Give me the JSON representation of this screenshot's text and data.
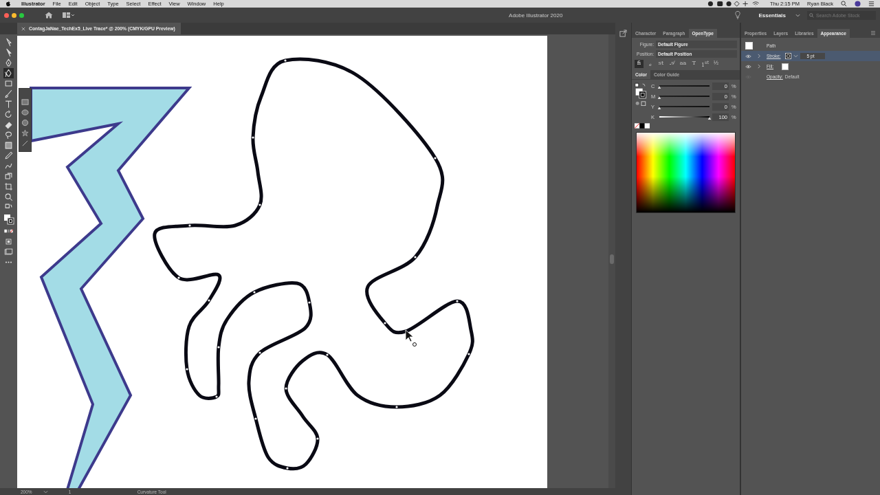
{
  "menu_bar": {
    "app": "Illustrator",
    "items": [
      "File",
      "Edit",
      "Object",
      "Type",
      "Select",
      "Effect",
      "View",
      "Window",
      "Help"
    ],
    "clock": "Thu 2:15 PM",
    "user": "Ryan Black"
  },
  "title_bar": {
    "title": "Adobe Illustrator 2020",
    "workspace": "Essentials",
    "search": {
      "placeholder": "Search Adobe Stock"
    }
  },
  "document_tab": {
    "title": "ContagJaNae_TechEx5_Live Trace* @ 200% (CMYK/GPU Preview)"
  },
  "toolbar": {
    "tools": [
      {
        "selected": false
      },
      {
        "selected": false
      },
      {
        "selected": false
      },
      {
        "selected": true
      },
      {
        "selected": false
      },
      {
        "selected": false
      },
      {
        "selected": false
      },
      {
        "selected": false
      },
      {
        "selected": false
      },
      {
        "selected": false
      },
      {
        "selected": false
      },
      {
        "selected": false
      },
      {
        "selected": false
      },
      {
        "selected": false
      },
      {
        "selected": false
      },
      {
        "selected": false
      },
      {
        "selected": false
      }
    ]
  },
  "opentype_panel": {
    "tabs": [
      {
        "label": "Character",
        "selected": false
      },
      {
        "label": "Paragraph",
        "selected": false
      },
      {
        "label": "OpenType",
        "selected": true
      }
    ],
    "figure": {
      "label": "Figure:",
      "value": "Default Figure"
    },
    "position": {
      "label": "Position:",
      "value": "Default Position"
    },
    "glyphs": [
      {
        "label": "ﬁ",
        "selected": true
      },
      {
        "label": "ℴ",
        "selected": false
      },
      {
        "label": "st",
        "selected": false
      },
      {
        "label": "𝒜",
        "selected": false
      },
      {
        "label": "aa",
        "selected": false
      },
      {
        "label": "T",
        "selected": false
      },
      {
        "label": "1$^{st}$",
        "selected": false
      },
      {
        "label": "½",
        "selected": false
      }
    ]
  },
  "color_panel": {
    "tabs": [
      {
        "label": "Color",
        "selected": true
      },
      {
        "label": "Color Guide",
        "selected": false
      }
    ],
    "channels": [
      {
        "name": "C",
        "level": 0,
        "value": "0",
        "unit": "%"
      },
      {
        "name": "M",
        "level": 0,
        "value": "0",
        "unit": "%"
      },
      {
        "name": "Y",
        "level": 0,
        "value": "0",
        "unit": "%"
      },
      {
        "name": "K",
        "level": 1,
        "value": "100",
        "unit": "%"
      }
    ]
  },
  "appearance_panel": {
    "tabs": [
      {
        "label": "Properties",
        "selected": false
      },
      {
        "label": "Layers",
        "selected": false
      },
      {
        "label": "Libraries",
        "selected": false
      },
      {
        "label": "Appearance",
        "selected": true
      }
    ],
    "title": "Path",
    "rows": [
      {
        "kind": "stroke",
        "label": "Stroke:",
        "value": "5 pt",
        "visible": true,
        "selected": true
      },
      {
        "kind": "fill",
        "label": "Fill:",
        "visible": true,
        "selected": false
      },
      {
        "kind": "opacity",
        "label": "Opacity:",
        "value": "Default",
        "visible": false,
        "selected": false
      }
    ]
  },
  "status_bar": {
    "zoom": "200%",
    "artboard": "1",
    "tool": "Curvature Tool"
  }
}
